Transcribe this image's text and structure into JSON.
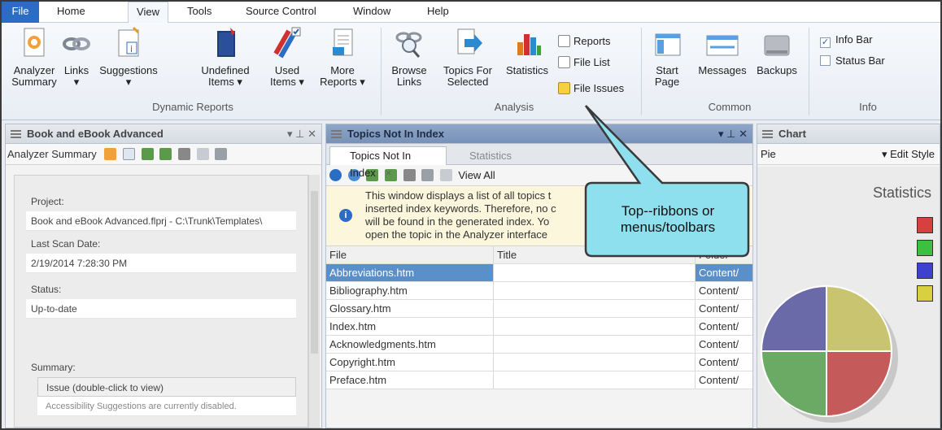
{
  "menu": {
    "items": [
      "File",
      "Home",
      "View",
      "Tools",
      "Source Control",
      "Window",
      "Help"
    ],
    "active": "View"
  },
  "ribbon": {
    "dynamic": {
      "group_label": "Dynamic Reports",
      "buttons": [
        {
          "label1": "Analyzer",
          "label2": "Summary",
          "icon": "analyzer-summary-icon"
        },
        {
          "label1": "Links",
          "label2": "▾",
          "icon": "links-icon"
        },
        {
          "label1": "Suggestions",
          "label2": "▾",
          "icon": "suggestions-icon"
        },
        {
          "label1": "Undefined",
          "label2": "Items ▾",
          "icon": "undefined-items-icon"
        },
        {
          "label1": "Used",
          "label2": "Items ▾",
          "icon": "used-items-icon"
        },
        {
          "label1": "More",
          "label2": "Reports ▾",
          "icon": "more-reports-icon"
        }
      ]
    },
    "analysis": {
      "group_label": "Analysis",
      "buttons": [
        {
          "label1": "Browse",
          "label2": "Links",
          "icon": "browse-links-icon"
        },
        {
          "label1": "Topics For",
          "label2": "Selected",
          "icon": "topics-for-selected-icon"
        },
        {
          "label1": "Statistics",
          "label2": "",
          "icon": "statistics-icon"
        }
      ],
      "small_buttons": [
        "Reports",
        "File List",
        "File Issues"
      ]
    },
    "common": {
      "group_label": "Common",
      "buttons": [
        {
          "label1": "Start",
          "label2": "Page",
          "icon": "start-page-icon"
        },
        {
          "label1": "Messages",
          "label2": "",
          "icon": "messages-icon"
        },
        {
          "label1": "Backups",
          "label2": "",
          "icon": "backups-icon"
        }
      ]
    },
    "info": {
      "group_label": "Info",
      "checkboxes": [
        {
          "label": "Info Bar",
          "checked": true
        },
        {
          "label": "Status Bar",
          "checked": false
        }
      ]
    }
  },
  "left_pane": {
    "title": "Book and eBook Advanced",
    "toolbar_label": "Analyzer Summary",
    "project_label": "Project:",
    "project_value": "Book and eBook Advanced.flprj - C:\\Trunk\\Templates\\",
    "scan_label": "Last Scan Date:",
    "scan_value": "2/19/2014 7:28:30 PM",
    "status_label": "Status:",
    "status_value": "Up-to-date",
    "summary_label": "Summary:",
    "summary_header": "Issue (double-click to view)",
    "summary_row": "Accessibility Suggestions are currently disabled."
  },
  "center_pane": {
    "title": "Topics Not In Index",
    "tabs": [
      "Topics Not In Index",
      "Statistics"
    ],
    "view_all": "View All",
    "info_lines": [
      "This window displays a list of all topics t",
      "inserted index keywords. Therefore, no c",
      "will be found in the generated index. Yo",
      "open the topic in the Analyzer interface"
    ],
    "columns": [
      "File",
      "Title",
      "Folder"
    ],
    "rows": [
      {
        "file": "Abbreviations.htm",
        "title": "",
        "folder": "Content/"
      },
      {
        "file": "Bibliography.htm",
        "title": "",
        "folder": "Content/"
      },
      {
        "file": "Glossary.htm",
        "title": "",
        "folder": "Content/"
      },
      {
        "file": "Index.htm",
        "title": "",
        "folder": "Content/"
      },
      {
        "file": "Acknowledgments.htm",
        "title": "",
        "folder": "Content/"
      },
      {
        "file": "Copyright.htm",
        "title": "",
        "folder": "Content/"
      },
      {
        "file": "Preface.htm",
        "title": "",
        "folder": "Content/"
      }
    ],
    "selected_row": 0
  },
  "right_pane": {
    "title": "Chart",
    "chart_type_value": "Pie",
    "edit_style": "▾ Edit Style",
    "chart_title": "Statistics",
    "legend_colors": [
      "#d84040",
      "#3cc040",
      "#4040d0",
      "#d8d040"
    ]
  },
  "callout": {
    "line1": "Top--ribbons or",
    "line2": "menus/toolbars"
  },
  "colors": {
    "accent": "#2b6cc4",
    "selected_row": "#5b8fc9",
    "callout_fill": "#8ee0ee"
  },
  "chart_data": {
    "type": "pie",
    "title": "Statistics",
    "values": [
      25,
      25,
      25,
      25
    ],
    "colors": [
      "#c8c470",
      "#c45a5a",
      "#6aaa64",
      "#6b6aa8"
    ]
  }
}
